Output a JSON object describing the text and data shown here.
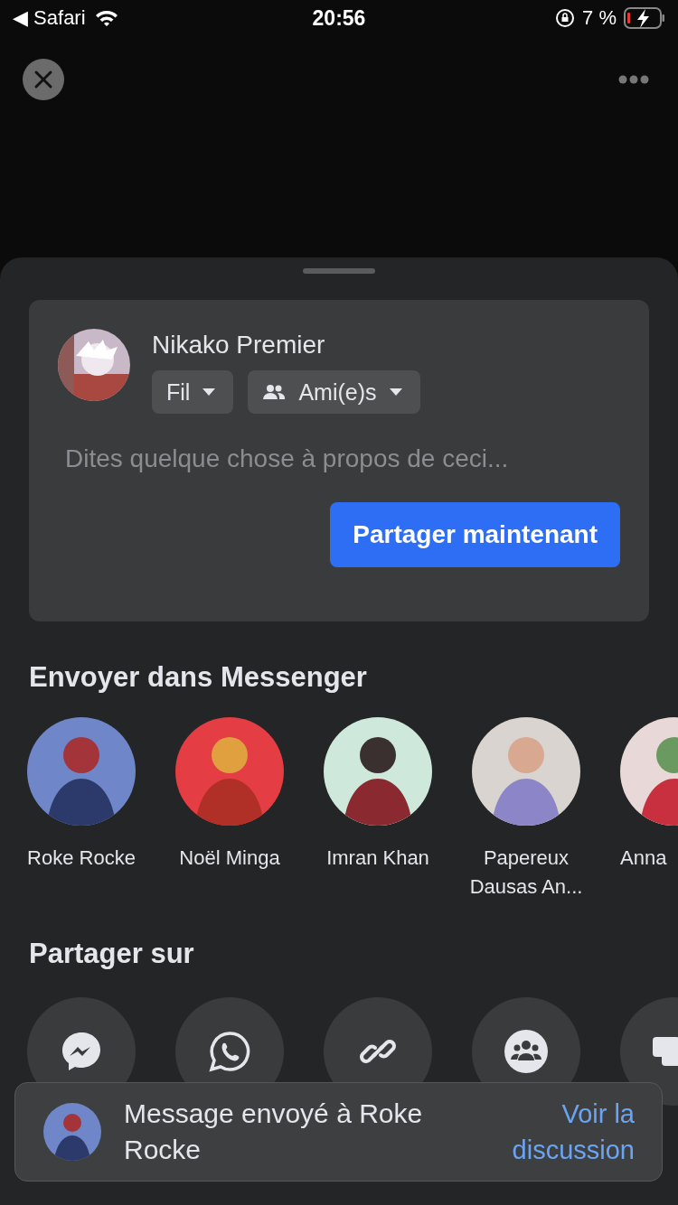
{
  "status_bar": {
    "back_label": "◀ Safari",
    "time": "20:56",
    "battery": "7 %"
  },
  "composer": {
    "author": "Nikako Premier",
    "audience_chips": [
      {
        "kind": "plain",
        "label": "Fil"
      },
      {
        "kind": "friends",
        "label": "Ami(e)s"
      }
    ],
    "placeholder": "Dites quelque chose à propos de ceci...",
    "share_button": "Partager maintenant"
  },
  "messenger": {
    "title": "Envoyer dans Messenger",
    "contacts": [
      {
        "name": "Roke Rocke"
      },
      {
        "name": "Noël Minga"
      },
      {
        "name": "Imran Khan"
      },
      {
        "name": "Papereux Dausas An..."
      },
      {
        "name": "Anna"
      }
    ]
  },
  "share_on": {
    "title": "Partager sur",
    "options": [
      {
        "kind": "messenger"
      },
      {
        "kind": "whatsapp"
      },
      {
        "kind": "link"
      },
      {
        "kind": "group"
      },
      {
        "kind": "chat"
      }
    ]
  },
  "toast": {
    "message": "Message envoyé à Roke Rocke",
    "action": "Voir la discussion"
  }
}
